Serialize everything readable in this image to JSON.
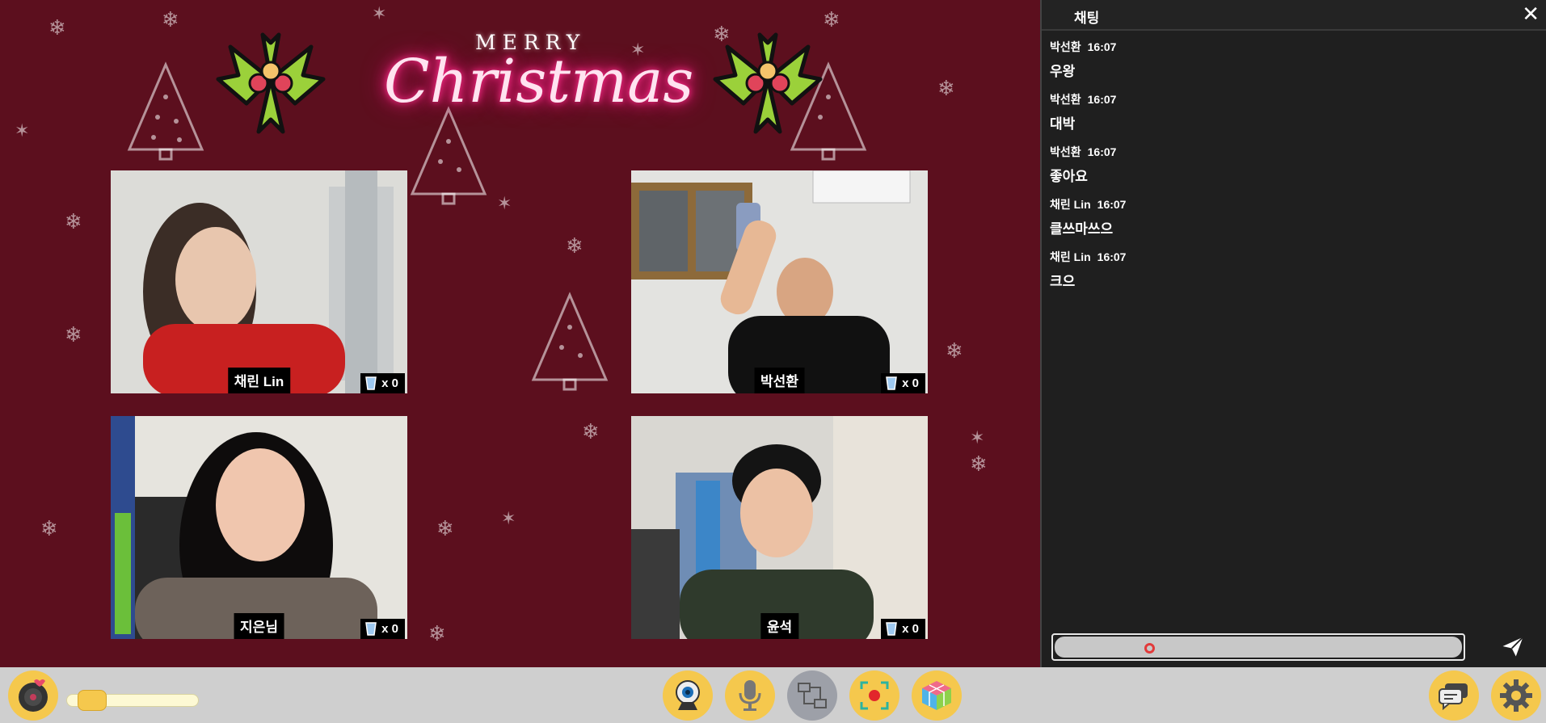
{
  "stage": {
    "title_small": "MERRY",
    "title_big": "Christmas"
  },
  "participants": [
    {
      "name": "채린 Lin",
      "drink_count": "x 0"
    },
    {
      "name": "박선환",
      "drink_count": "x 0"
    },
    {
      "name": "지은님",
      "drink_count": "x 0"
    },
    {
      "name": "윤석",
      "drink_count": "x 0"
    }
  ],
  "chat": {
    "title": "채팅",
    "close_icon": "✕",
    "messages": [
      {
        "author": "박선환",
        "time": "16:07",
        "text": "우왕"
      },
      {
        "author": "박선환",
        "time": "16:07",
        "text": "대박"
      },
      {
        "author": "박선환",
        "time": "16:07",
        "text": "좋아요"
      },
      {
        "author": "채린 Lin",
        "time": "16:07",
        "text": "클쓰마쓰으"
      },
      {
        "author": "채린 Lin",
        "time": "16:07",
        "text": "크으"
      }
    ],
    "input_value": "",
    "input_placeholder": ""
  },
  "toolbar": {
    "volume_level": 0.1,
    "icons": [
      "music-disc-icon",
      "webcam-icon",
      "microphone-icon",
      "layout-icon",
      "record-icon",
      "cube-game-icon",
      "chat-bubble-icon",
      "gear-icon"
    ]
  },
  "colors": {
    "stage_bg": "#5c0f1e",
    "accent_yellow": "#f5c84d",
    "neon_pink": "#ff2d8a",
    "chat_bg": "#1f1f1f"
  }
}
